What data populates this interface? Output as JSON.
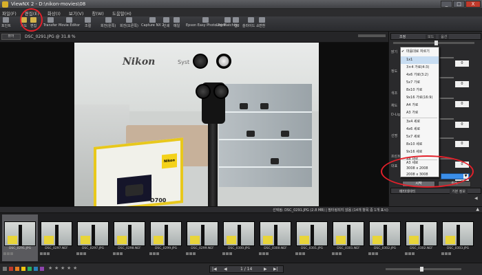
{
  "titlebar": {
    "title": "ViewNX 2 - D:\\nikon-movies\\08"
  },
  "window_controls": {
    "minimize": "_",
    "maximize": "□",
    "close": "X"
  },
  "menu": [
    "파일(F)",
    "편집(E)",
    "화상(I)",
    "보기(V)",
    "창(W)",
    "도움말(H)"
  ],
  "toolbar": [
    {
      "label": "포인트",
      "icon": "browser-icon"
    },
    {
      "label": "지도",
      "icon": "map-icon"
    },
    {
      "label": "편집",
      "icon": "edit-icon"
    },
    {
      "label": "Transfer",
      "icon": "transfer-icon"
    },
    {
      "label": "Movie Editor",
      "icon": "movie-editor-icon"
    },
    {
      "label": "조절",
      "icon": "adjust-icon"
    },
    {
      "label": "회전(왼쪽)",
      "icon": "rotate-left-icon"
    },
    {
      "label": "회전(오른쪽)",
      "icon": "rotate-right-icon"
    },
    {
      "label": "Capture NX 2",
      "icon": "capture-nx-icon"
    },
    {
      "label": "인쇄",
      "icon": "print-icon"
    },
    {
      "label": "메일",
      "icon": "mail-icon"
    },
    {
      "label": "Epson Easy Photo Print",
      "icon": "easy-print-icon"
    },
    {
      "label": "Log Matching",
      "icon": "log-matching-icon"
    },
    {
      "label": "웹",
      "icon": "web-icon"
    },
    {
      "label": "슬라이드 쇼",
      "icon": "slideshow-icon"
    },
    {
      "label": "변환",
      "icon": "convert-icon"
    }
  ],
  "viewer": {
    "mode_button": "뷰어",
    "file_label": "DSC_0291.JPG @ 31.8 %",
    "photo_sign": "Nikon",
    "photo_sign2": "Syst",
    "photo_model": "D700",
    "photo_badge": "Nikon"
  },
  "right_panel": {
    "header": "조정",
    "tabs": [
      "모드",
      "옵션"
    ],
    "section_labels": [
      "밝기",
      "정도",
      "색조",
      "채도",
      "D-Light",
      "선명",
      "프린트",
      "대표"
    ],
    "field_values": [
      "0",
      "0",
      "0",
      "0",
      "0",
      "0",
      "0"
    ],
    "footer_label": "메타데이터",
    "footer_tab": "기본 정보",
    "buttons": [
      "시작",
      "취소"
    ]
  },
  "crop_menu": {
    "items": [
      {
        "label": "마음대로 자르기",
        "checked": true
      },
      {
        "label": "1x1",
        "hover": true
      },
      {
        "label": "3×4 가로(4:3)"
      },
      {
        "label": "4x6 가로(3:2)"
      },
      {
        "label": "5x7 가로"
      },
      {
        "label": "8x10 가로"
      },
      {
        "label": "9x16 가로(16:9)"
      },
      {
        "label": "A4 가로"
      },
      {
        "label": "A3 가로"
      },
      {
        "label": "3x4 세로"
      },
      {
        "label": "4x6 세로"
      },
      {
        "label": "5x7 세로"
      },
      {
        "label": "8x10 세로"
      },
      {
        "label": "9x16 세로"
      },
      {
        "label": "A4 세로"
      },
      {
        "label": "A3 세로"
      },
      {
        "label": "3008 x 2008"
      },
      {
        "label": "2008 x 3008"
      }
    ]
  },
  "filmstrip": {
    "status": "선택됨: DSC_0291.JPG (2.8 MB) | 필터링되지 않음 (14개 항목 중 1개 표시)",
    "thumbnails": [
      {
        "name": "DSC_0291.JPG",
        "selected": true
      },
      {
        "name": "DSC_0297.NEF"
      },
      {
        "name": "DSC_0297.JPG"
      },
      {
        "name": "DSC_0298.NEF"
      },
      {
        "name": "DSC_0299.JPG"
      },
      {
        "name": "DSC_0299.NEF"
      },
      {
        "name": "DSC_0300.JPG"
      },
      {
        "name": "DSC_0300.NEF"
      },
      {
        "name": "DSC_0301.JPG"
      },
      {
        "name": "DSC_0301.NEF"
      },
      {
        "name": "DSC_0302.JPG"
      },
      {
        "name": "DSC_0302.NEF"
      },
      {
        "name": "DSC_0303.JPG"
      }
    ]
  },
  "bottombar": {
    "page": "1 / 14",
    "label_colors": [
      "#777777",
      "#c0392b",
      "#e67e22",
      "#f1c40f",
      "#27ae60",
      "#2980b9",
      "#8e44ad"
    ],
    "nav": {
      "first": "|◀",
      "prev": "◀",
      "next": "▶",
      "last": "▶|"
    }
  },
  "colors": {
    "annotation": "#e3202a",
    "highlight": "#3b8ee8"
  }
}
